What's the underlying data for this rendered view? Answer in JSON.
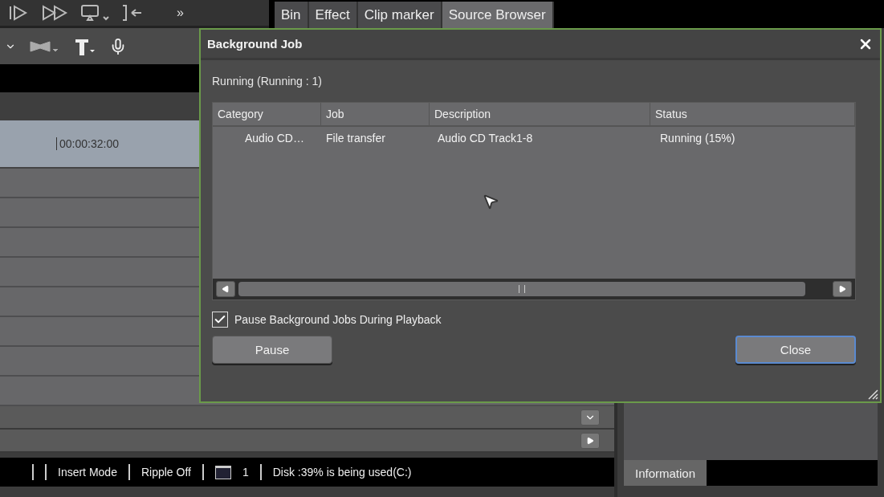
{
  "toolbar": {
    "overflow": "»"
  },
  "panel_tabs": [
    {
      "label": "Bin",
      "selected": false
    },
    {
      "label": "Effect",
      "selected": false
    },
    {
      "label": "Clip marker",
      "selected": false
    },
    {
      "label": "Source Browser",
      "selected": true
    }
  ],
  "timeline": {
    "timecode": "00:00:32:00"
  },
  "status_bar": {
    "items": [
      {
        "kind": "text",
        "text": "Insert Mode"
      },
      {
        "kind": "text",
        "text": "Ripple Off"
      },
      {
        "kind": "window-count",
        "text": "1"
      },
      {
        "kind": "text",
        "text": "Disk :39% is being used(C:)"
      }
    ]
  },
  "info_tabs": [
    {
      "label": "Information",
      "selected": true
    }
  ],
  "dialog": {
    "title": "Background Job",
    "summary": "Running (Running : 1)",
    "columns": [
      "Category",
      "Job",
      "Description",
      "Status"
    ],
    "rows": [
      {
        "category": "Audio CD…",
        "job": "File transfer",
        "description": "Audio CD Track1-8",
        "status": "Running (15%)"
      }
    ],
    "checkbox": {
      "label": "Pause Background Jobs During Playback",
      "checked": true
    },
    "buttons": [
      {
        "label": "Pause",
        "focused": false
      },
      {
        "label": "Close",
        "focused": true
      }
    ]
  }
}
